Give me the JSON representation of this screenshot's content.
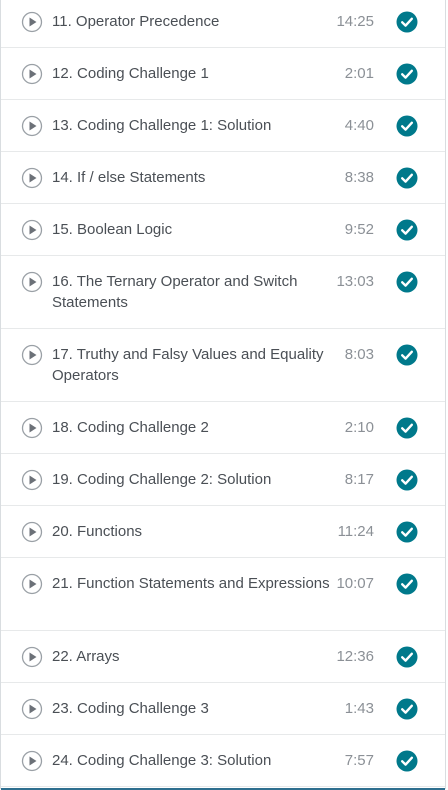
{
  "colors": {
    "check_fill": "#00798b",
    "play_fill": "#ffffff",
    "play_stroke": "#9aa0a6",
    "play_triangle": "#6c7178",
    "bottom_bar": "#2f6f8f"
  },
  "icons": {
    "play": "play-circle-icon",
    "completed": "check-circle-icon"
  },
  "lectures": [
    {
      "title": "11. Operator Precedence",
      "duration": "14:25",
      "lines": 1
    },
    {
      "title": "12. Coding Challenge 1",
      "duration": "2:01",
      "lines": 1
    },
    {
      "title": "13. Coding Challenge 1: Solution",
      "duration": "4:40",
      "lines": 1
    },
    {
      "title": "14. If / else Statements",
      "duration": "8:38",
      "lines": 1
    },
    {
      "title": "15. Boolean Logic",
      "duration": "9:52",
      "lines": 1
    },
    {
      "title": "16. The Ternary Operator and Switch Statements",
      "duration": "13:03",
      "lines": 2
    },
    {
      "title": "17. Truthy and Falsy Values and Equality Operators",
      "duration": "8:03",
      "lines": 2
    },
    {
      "title": "18. Coding Challenge 2",
      "duration": "2:10",
      "lines": 1
    },
    {
      "title": "19. Coding Challenge 2: Solution",
      "duration": "8:17",
      "lines": 1
    },
    {
      "title": "20. Functions",
      "duration": "11:24",
      "lines": 1
    },
    {
      "title": "21. Function Statements and Expressions",
      "duration": "10:07",
      "lines": 2
    },
    {
      "title": "22. Arrays",
      "duration": "12:36",
      "lines": 1
    },
    {
      "title": "23. Coding Challenge 3",
      "duration": "1:43",
      "lines": 1
    },
    {
      "title": "24. Coding Challenge 3: Solution",
      "duration": "7:57",
      "lines": 1
    }
  ]
}
